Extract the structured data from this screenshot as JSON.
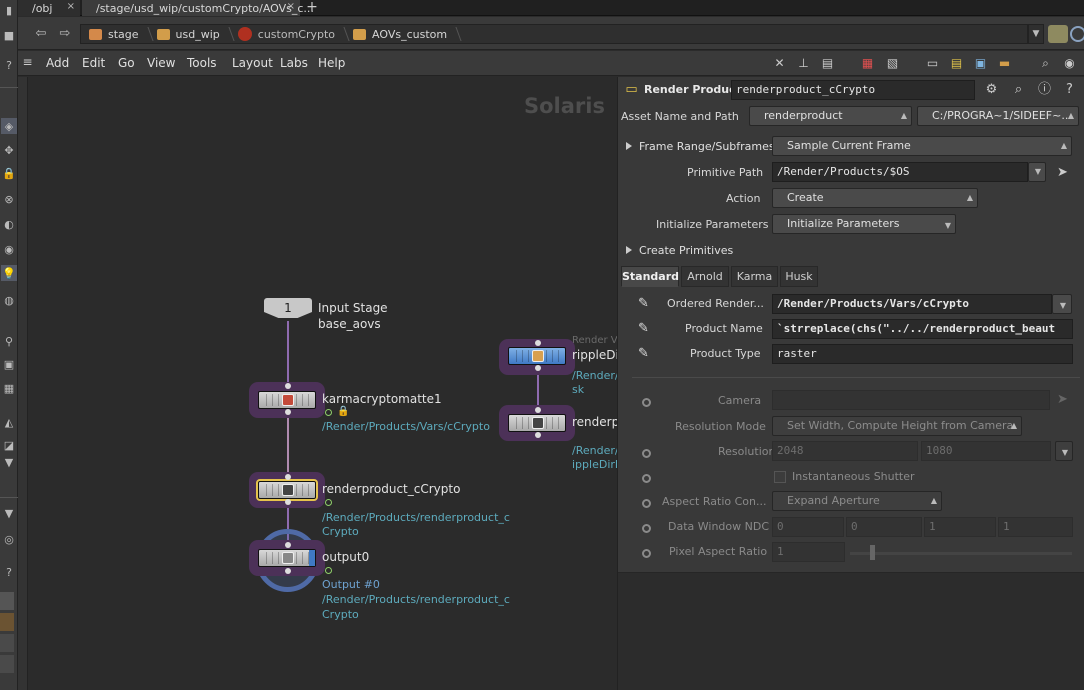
{
  "tabs": [
    {
      "label": "/obj"
    },
    {
      "label": "/stage/usd_wip/customCrypto/AOVs_c..."
    }
  ],
  "tab_close": "×",
  "tab_add": "+",
  "nav": {
    "back": "⇦",
    "forward": "⇨"
  },
  "breadcrumbs": [
    "stage",
    "usd_wip",
    "customCrypto",
    "AOVs_custom"
  ],
  "crumb_dropdown": "▼",
  "menu": [
    "Add",
    "Edit",
    "Go",
    "View",
    "Tools",
    "Layout",
    "Labs",
    "Help"
  ],
  "network": {
    "watermark": "Solaris",
    "input_stage": {
      "index": "1",
      "label": "Input Stage",
      "sublabel": "base_aovs"
    },
    "nodes": [
      {
        "name": "karmacryptomatte1",
        "path": "/Render/Products/Vars/cCrypto"
      },
      {
        "name": "renderproduct_cCrypto",
        "path1": "/Render/Products/renderproduct_c",
        "path2": "Crypto"
      },
      {
        "name": "output0",
        "output": "Output #0",
        "path1": "/Render/Products/renderproduct_c",
        "path2": "Crypto"
      }
    ],
    "side_nodes": {
      "caption": "Render V",
      "node1_name": "rippleDir",
      "node1_sub1": "/Render/F",
      "node1_sub2": "sk",
      "node2_name": "renderpr",
      "node2_sub1": "/Render/F",
      "node2_sub2": "ippleDirM"
    }
  },
  "params": {
    "node_type": "Render Product",
    "node_name": "renderproduct_cCrypto",
    "asset_label": "Asset Name and Path",
    "asset_menu": "renderproduct",
    "asset_path": "C:/PROGRA~1/SIDEEF~...",
    "frame_range_folder": "Frame Range/Subframes",
    "frame_range_value": "Sample Current Frame",
    "primitive_path_label": "Primitive Path",
    "primitive_path": "/Render/Products/$OS",
    "action_label": "Action",
    "action_value": "Create",
    "init_label": "Initialize Parameters",
    "init_value": "Initialize Parameters",
    "create_prims_folder": "Create Primitives",
    "tabs": [
      "Standard",
      "Arnold",
      "Karma",
      "Husk"
    ],
    "ordered_label": "Ordered Render...",
    "ordered_value": "/Render/Products/Vars/cCrypto",
    "product_name_label": "Product Name",
    "product_name_value": "`strreplace(chs(\"../../renderproduct_beaut",
    "product_type_label": "Product Type",
    "product_type_value": "raster",
    "camera_label": "Camera",
    "res_mode_label": "Resolution Mode",
    "res_mode_value": "Set Width, Compute Height from Camera",
    "resolution_label": "Resolution",
    "res_w": "2048",
    "res_h": "1080",
    "instant_shutter": "Instantaneous Shutter",
    "aspect_label": "Aspect Ratio Con...",
    "aspect_value": "Expand Aperture",
    "window_label": "Data Window NDC",
    "window": [
      "0",
      "0",
      "1",
      "1"
    ],
    "pixel_aspect_label": "Pixel Aspect Ratio",
    "pixel_aspect_value": "1"
  },
  "colors": {
    "accent": "#e5c34d",
    "wire": "#8f6bb0",
    "path_text": "#5dabbd"
  }
}
